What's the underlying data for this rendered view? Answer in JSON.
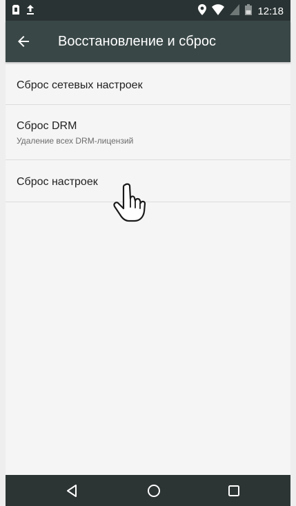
{
  "status_bar": {
    "time": "12:18",
    "icons": [
      "sd-card-icon",
      "upload-icon",
      "location-icon",
      "wifi-icon",
      "signal-icon",
      "battery-icon"
    ]
  },
  "app_bar": {
    "title": "Восстановление и сброс",
    "back_icon": "arrow-left-icon"
  },
  "items": [
    {
      "title": "Сброс сетевых настроек"
    },
    {
      "title": "Сброс DRM",
      "subtitle": "Удаление всех DRM-лицензий"
    },
    {
      "title": "Сброс настроек"
    }
  ],
  "nav_bar": {
    "icons": [
      "back-triangle-icon",
      "home-circle-icon",
      "recent-square-icon"
    ]
  },
  "colors": {
    "status_bar": "#2a3333",
    "app_bar": "#3a4747",
    "nav_bar": "#2d3434",
    "background": "#f5f5f5",
    "divider": "#dcdcdc"
  }
}
